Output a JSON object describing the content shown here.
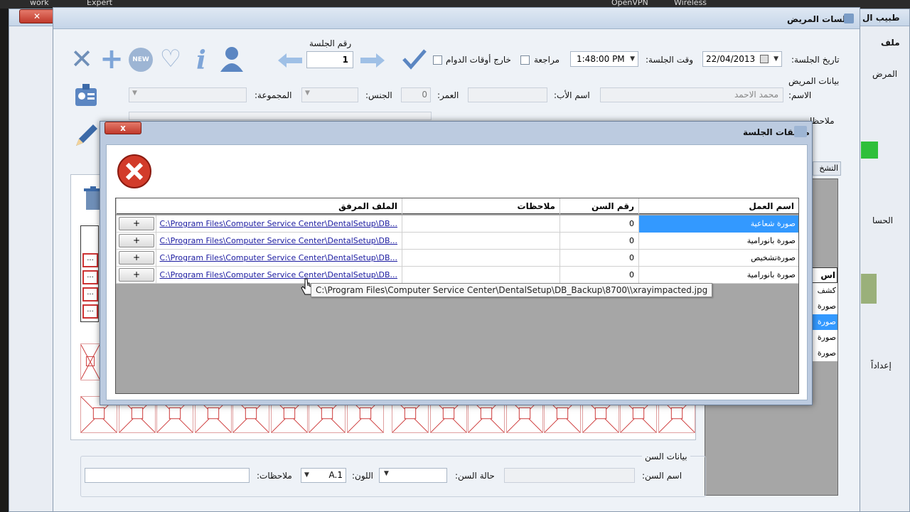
{
  "taskbar": {
    "item1": "work",
    "item2": "Expert",
    "item3": "OpenVPN",
    "item4": "Wireless"
  },
  "outer_window": {
    "title": "طبيب ال",
    "menu_file": "ملف",
    "side_label1": "المرض",
    "side_label2": "الحسا",
    "side_label3": "إعداداً"
  },
  "main_window": {
    "title": "جلسات المريض",
    "session_date_label": "تاريخ الجلسة:",
    "session_date_value": "22/04/2013",
    "session_time_label": "وقت الجلسة:",
    "session_time_value": "1:48:00 PM",
    "review_label": "مراجعة",
    "outside_hours_label": "خارج أوقات الدوام",
    "session_number_label": "رقم الجلسة",
    "session_number_value": "1",
    "patient_data_label": "بيانات المريض",
    "name_label": "الاسم:",
    "name_value": "محمد الاحمد",
    "father_name_label": "اسم الأب:",
    "age_label": "العمر:",
    "age_value": "0",
    "gender_label": "الجنس:",
    "group_label": "المجموعة:",
    "notes_partial_label": "ملاحظا",
    "diagnosis_tab_label": "التشخ",
    "work_list_header": "اس",
    "work_list_items": [
      "كشف",
      "صورة",
      "صورة",
      "صورة",
      "صورة"
    ],
    "tooth_data_label": "بيانات السن",
    "tooth_name_label": "اسم السن:",
    "tooth_status_label": "حالة السن:",
    "color_label": "اللون:",
    "color_value": "A.1",
    "tooth_notes_label": "ملاحظات:",
    "small_btn_label": "..."
  },
  "dialog": {
    "title": "مرفقات الجلسة",
    "close_symbol": "x",
    "columns": {
      "work_name": "اسم العمل",
      "tooth_number": "رقم السن",
      "notes": "ملاحظات",
      "attachment": "الملف المرفق"
    },
    "rows": [
      {
        "work_name": "صورة شعاعية",
        "tooth_number": "0",
        "notes": "",
        "attachment": "C:\\Program Files\\Computer Service Center\\DentalSetup\\DB...",
        "button": "+"
      },
      {
        "work_name": "صورة بانورامية",
        "tooth_number": "0",
        "notes": "",
        "attachment": "C:\\Program Files\\Computer Service Center\\DentalSetup\\DB...",
        "button": "+"
      },
      {
        "work_name": "صورةتشخيص",
        "tooth_number": "0",
        "notes": "",
        "attachment": "C:\\Program Files\\Computer Service Center\\DentalSetup\\DB...",
        "button": "+"
      },
      {
        "work_name": "صورة بانورامية",
        "tooth_number": "0",
        "notes": "",
        "attachment": "C:\\Program Files\\Computer Service Center\\DentalSetup\\DB...",
        "button": "+"
      }
    ],
    "tooltip": "C:\\Program Files\\Computer Service Center\\DentalSetup\\DB_Backup\\8700\\\\xrayimpacted.jpg"
  },
  "colors": {
    "selected_row": "#3399ff",
    "link": "#1a1aa0",
    "delete_red": "#c0392b",
    "tooth_border": "#cc3333"
  },
  "icons": [
    "close-icon",
    "add-icon",
    "new-icon",
    "favorite-add-icon",
    "info-icon",
    "user-icon",
    "arrow-left-icon",
    "arrow-right-icon",
    "checkmark-icon",
    "patient-card-icon",
    "edit-pencil-icon",
    "trash-icon",
    "error-icon",
    "tools-icon"
  ]
}
